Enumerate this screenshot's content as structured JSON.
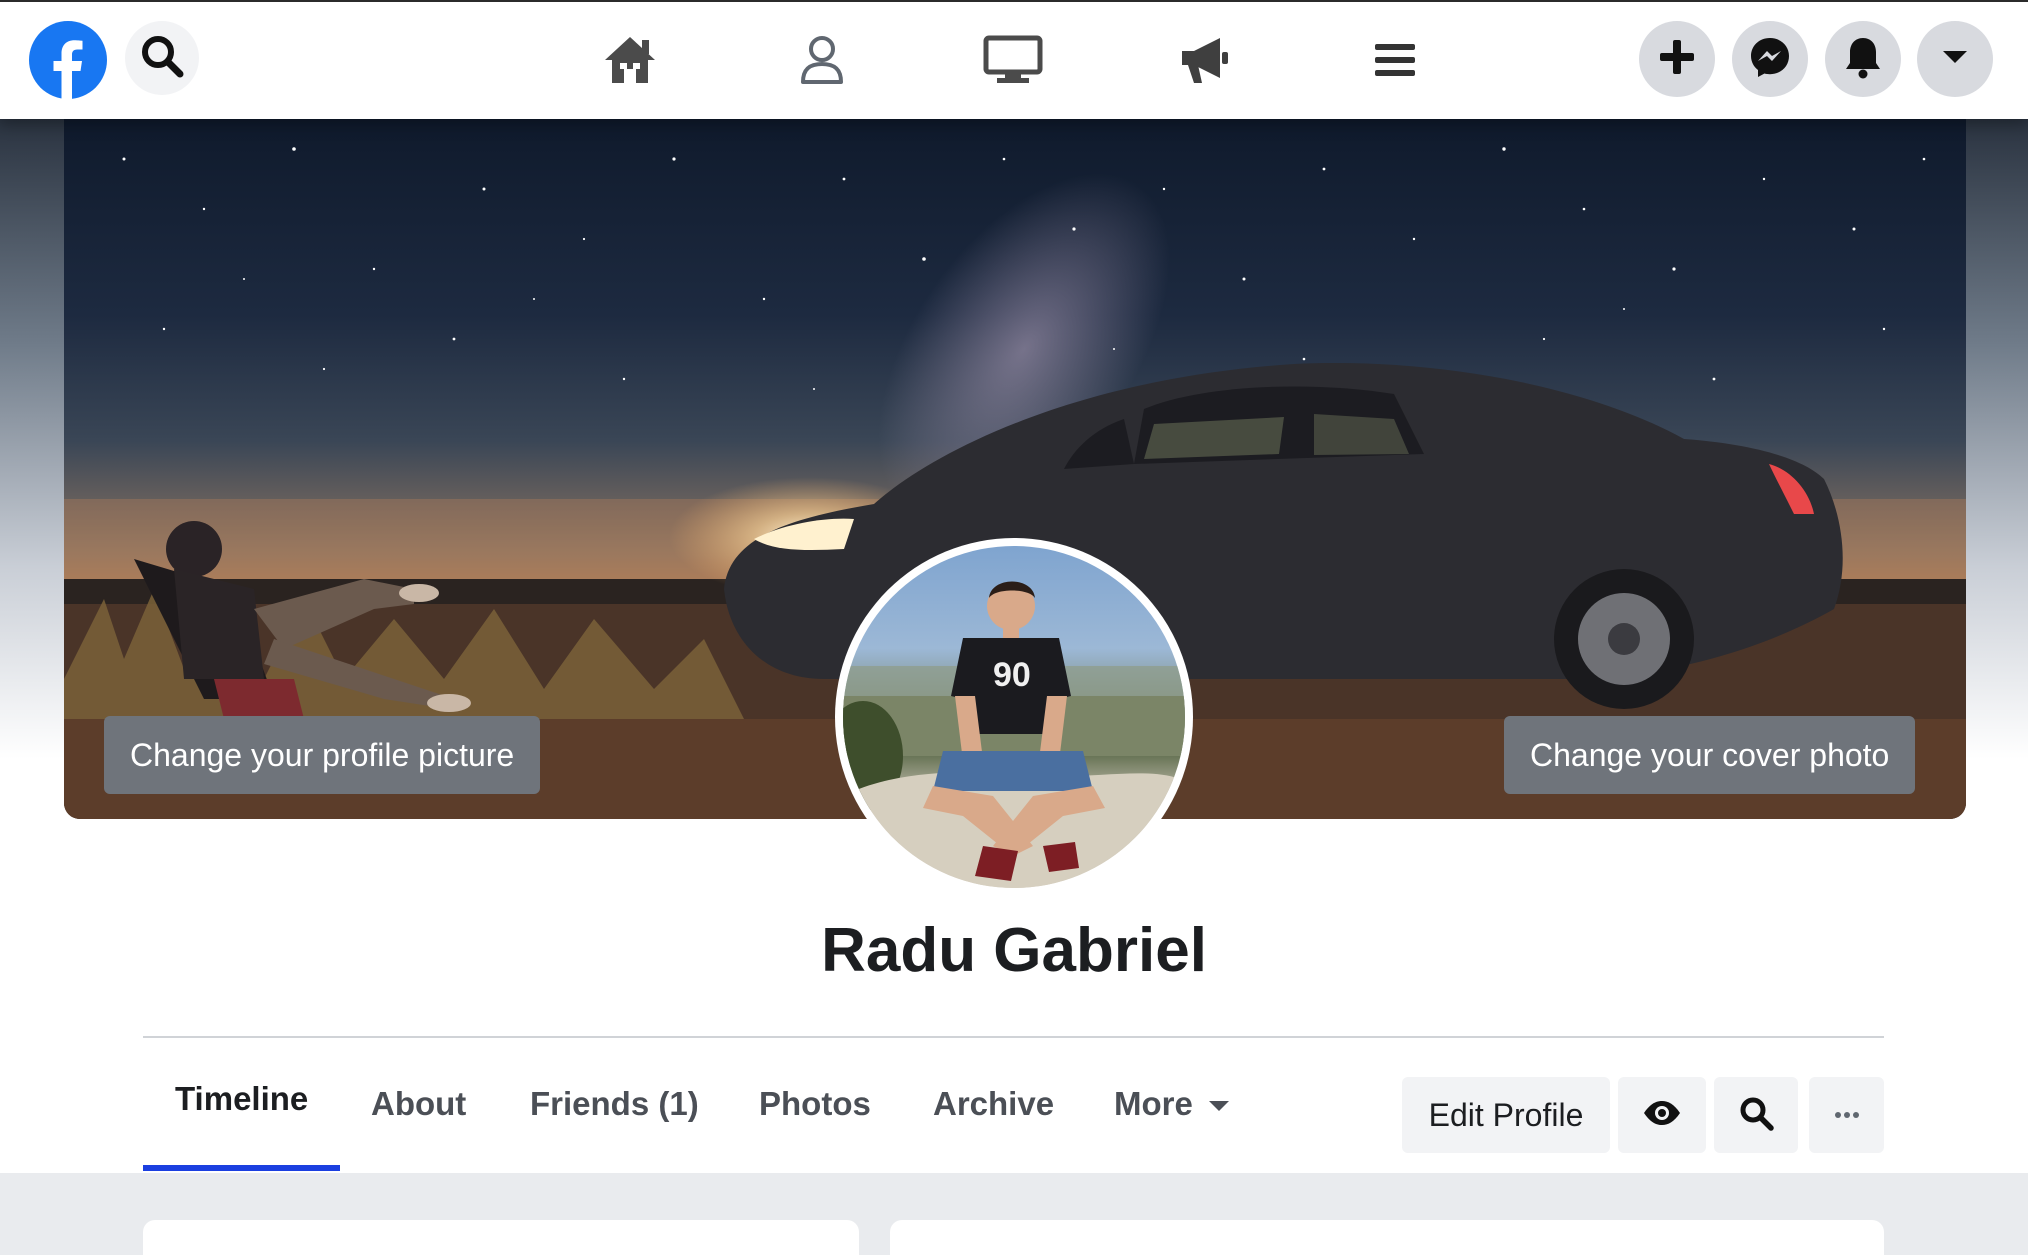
{
  "topbar": {
    "logo": "facebook-logo",
    "icons": [
      "search-icon",
      "home-icon",
      "profile-icon",
      "watch-icon",
      "megaphone-icon",
      "menu-icon",
      "plus-icon",
      "messenger-icon",
      "bell-icon",
      "caret-down-icon"
    ]
  },
  "cover": {
    "change_profile_picture_label": "Change your profile picture",
    "change_cover_photo_label": "Change your cover photo"
  },
  "profile": {
    "name": "Radu Gabriel",
    "shirt_text": "90"
  },
  "tabs": [
    {
      "label": "Timeline",
      "active": true
    },
    {
      "label": "About",
      "active": false
    },
    {
      "label": "Friends (1)",
      "active": false
    },
    {
      "label": "Photos",
      "active": false
    },
    {
      "label": "Archive",
      "active": false
    },
    {
      "label": "More",
      "active": false
    }
  ],
  "actions": {
    "edit_profile_label": "Edit Profile",
    "icons": [
      "eye-icon",
      "search-icon",
      "more-dots-icon"
    ]
  },
  "colors": {
    "brand_blue": "#1877f2",
    "active_tab_underline": "#1b3fe0",
    "round_button_bg": "#d8dadf",
    "cover_button_bg": "#6f747b"
  }
}
